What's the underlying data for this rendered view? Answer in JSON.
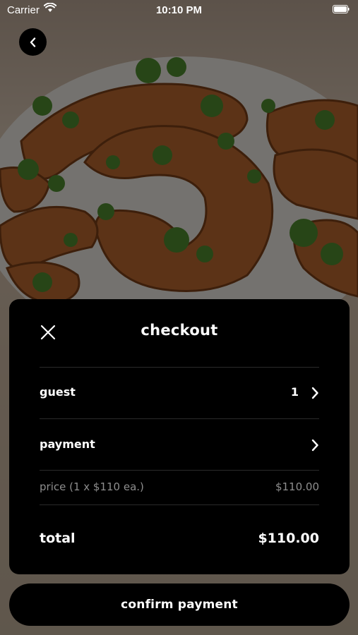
{
  "status_bar": {
    "carrier": "Carrier",
    "time": "10:10 PM"
  },
  "icons": {
    "back": "chevron-left-icon",
    "close": "close-icon",
    "chevron": "chevron-right-icon",
    "wifi": "wifi-icon",
    "battery": "battery-icon"
  },
  "checkout": {
    "title": "checkout",
    "guest": {
      "label": "guest",
      "value": "1"
    },
    "payment": {
      "label": "payment"
    },
    "price": {
      "label": "price (1 x $110 ea.)",
      "value": "$110.00"
    },
    "total": {
      "label": "total",
      "value": "$110.00"
    }
  },
  "confirm": {
    "label": "confirm payment"
  },
  "colors": {
    "sheet_background": "#000000",
    "primary_text": "#ffffff",
    "muted_text": "#8e8e8e",
    "overlay": "rgba(0,0,0,0.5)"
  }
}
